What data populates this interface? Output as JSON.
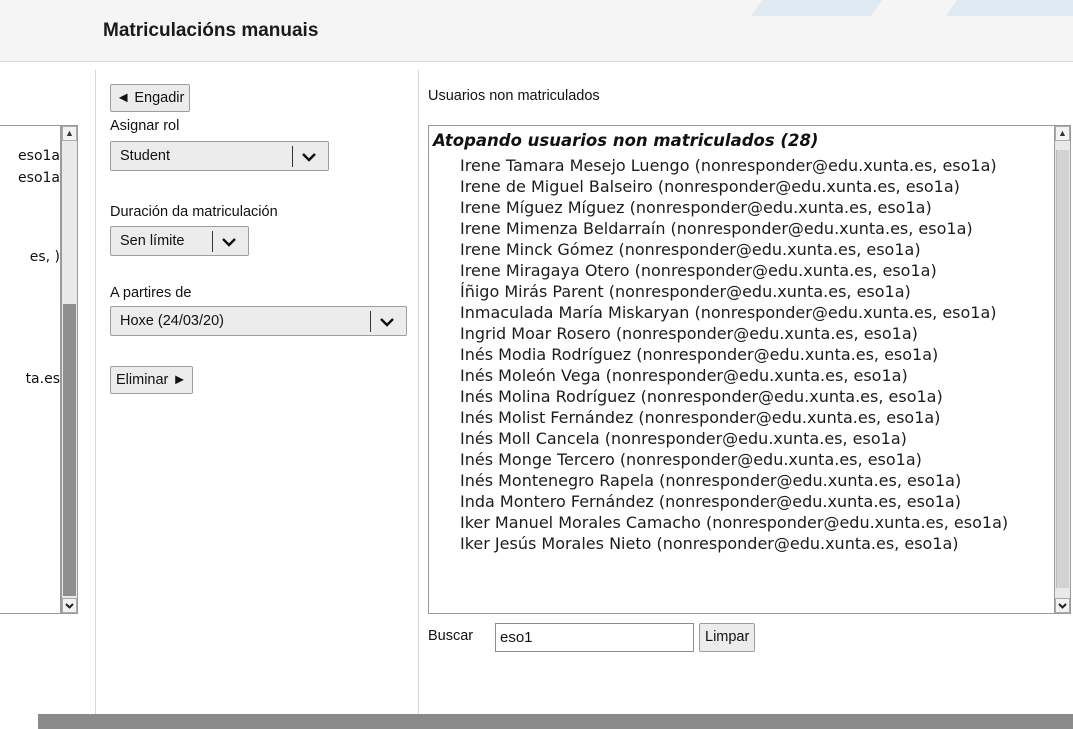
{
  "page": {
    "title": "Matriculacións manuais"
  },
  "left_panel": {
    "fragments": [
      "eso1a",
      "eso1a",
      "es, )",
      "ta.es"
    ]
  },
  "controls": {
    "add_button": "◄ Engadir",
    "assign_role_label": "Asignar rol",
    "role_value": "Student",
    "duration_label": "Duración da matriculación",
    "duration_value": "Sen límite",
    "start_label": "A partires de",
    "start_value": "Hoxe (24/03/20)",
    "remove_button": "Eliminar ►"
  },
  "not_enrolled": {
    "heading": "Usuarios non matriculados",
    "group_label": "Atopando usuarios non matriculados (28)",
    "options": [
      "Irene Tamara Mesejo Luengo (nonresponder@edu.xunta.es, eso1a)",
      "Irene de Miguel Balseiro (nonresponder@edu.xunta.es, eso1a)",
      "Irene Míguez Míguez (nonresponder@edu.xunta.es, eso1a)",
      "Irene Mimenza Beldarraín (nonresponder@edu.xunta.es, eso1a)",
      "Irene Minck Gómez (nonresponder@edu.xunta.es, eso1a)",
      "Irene Miragaya Otero (nonresponder@edu.xunta.es, eso1a)",
      "Íñigo Mirás Parent (nonresponder@edu.xunta.es, eso1a)",
      "Inmaculada María Miskaryan (nonresponder@edu.xunta.es, eso1a)",
      "Ingrid Moar Rosero (nonresponder@edu.xunta.es, eso1a)",
      "Inés Modia Rodríguez (nonresponder@edu.xunta.es, eso1a)",
      "Inés Moleón Vega (nonresponder@edu.xunta.es, eso1a)",
      "Inés Molina Rodríguez (nonresponder@edu.xunta.es, eso1a)",
      "Inés Molist Fernández (nonresponder@edu.xunta.es, eso1a)",
      "Inés Moll Cancela (nonresponder@edu.xunta.es, eso1a)",
      "Inés Monge Tercero (nonresponder@edu.xunta.es, eso1a)",
      "Inés Montenegro Rapela (nonresponder@edu.xunta.es, eso1a)",
      "Inda Montero Fernández (nonresponder@edu.xunta.es, eso1a)",
      "Iker Manuel Morales Camacho (nonresponder@edu.xunta.es, eso1a)",
      "Iker Jesús Morales Nieto (nonresponder@edu.xunta.es, eso1a)"
    ]
  },
  "search": {
    "label": "Buscar",
    "value": "eso1",
    "clear_button": "Limpar"
  }
}
